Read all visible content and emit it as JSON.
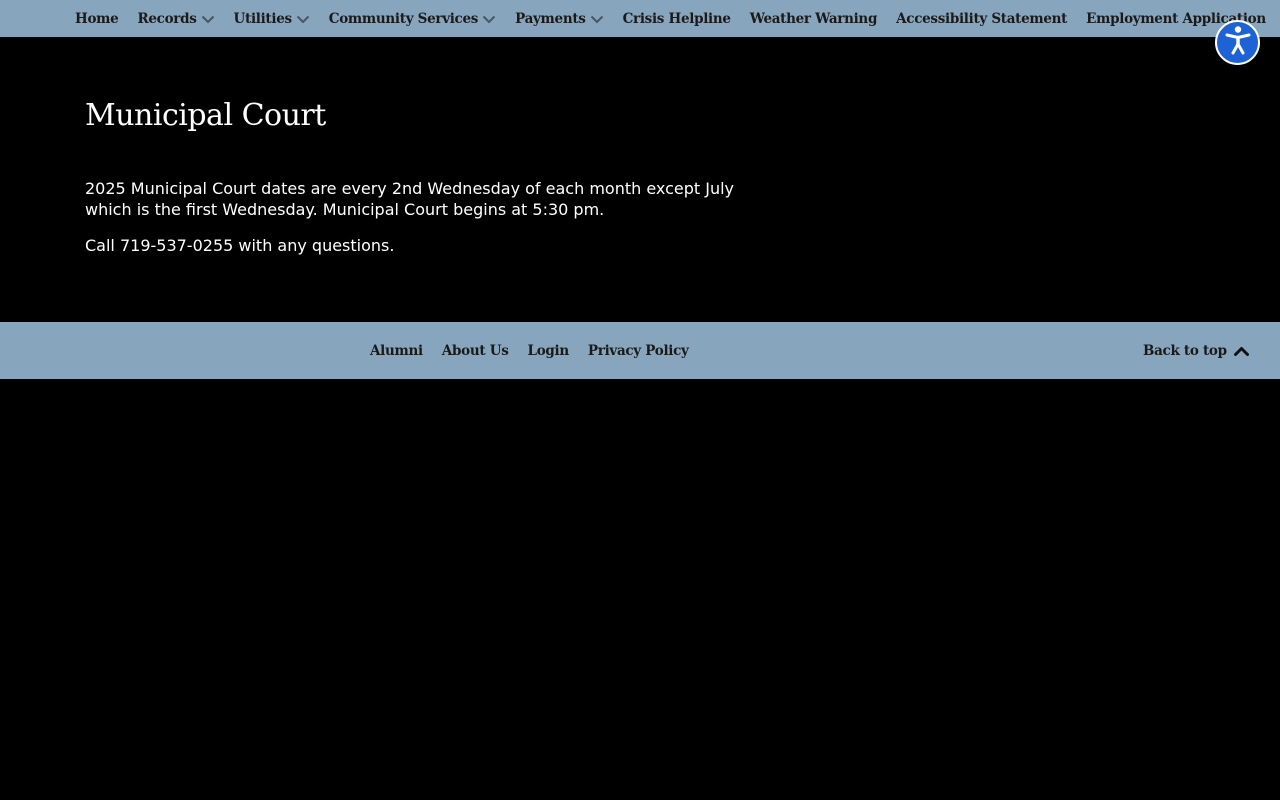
{
  "nav": {
    "items": [
      {
        "label": "Home",
        "dropdown": false
      },
      {
        "label": "Records",
        "dropdown": true
      },
      {
        "label": "Utilities",
        "dropdown": true
      },
      {
        "label": "Community Services",
        "dropdown": true
      },
      {
        "label": "Payments",
        "dropdown": true
      },
      {
        "label": "Crisis Helpline",
        "dropdown": false
      },
      {
        "label": "Weather Warning",
        "dropdown": false
      },
      {
        "label": "Accessibility Statement",
        "dropdown": false
      },
      {
        "label": "Employment Application",
        "dropdown": false
      }
    ]
  },
  "accessibility_button": {
    "icon": "accessibility-icon",
    "color": "#1d63d6"
  },
  "main": {
    "title": "Municipal Court",
    "paragraph1": "2025 Municipal Court dates are every 2nd Wednesday of each month except July which is the first Wednesday. Municipal Court begins at 5:30 pm.",
    "paragraph2": "Call 719-537-0255 with any questions."
  },
  "footer": {
    "links": [
      {
        "label": "Alumni"
      },
      {
        "label": "About Us"
      },
      {
        "label": "Login"
      },
      {
        "label": "Privacy Policy"
      }
    ],
    "back_to_top": "Back to top"
  },
  "colors": {
    "nav_background": "#87a5bd",
    "page_background": "#000000",
    "text": "#ffffff",
    "accessibility_blue": "#1d63d6"
  }
}
